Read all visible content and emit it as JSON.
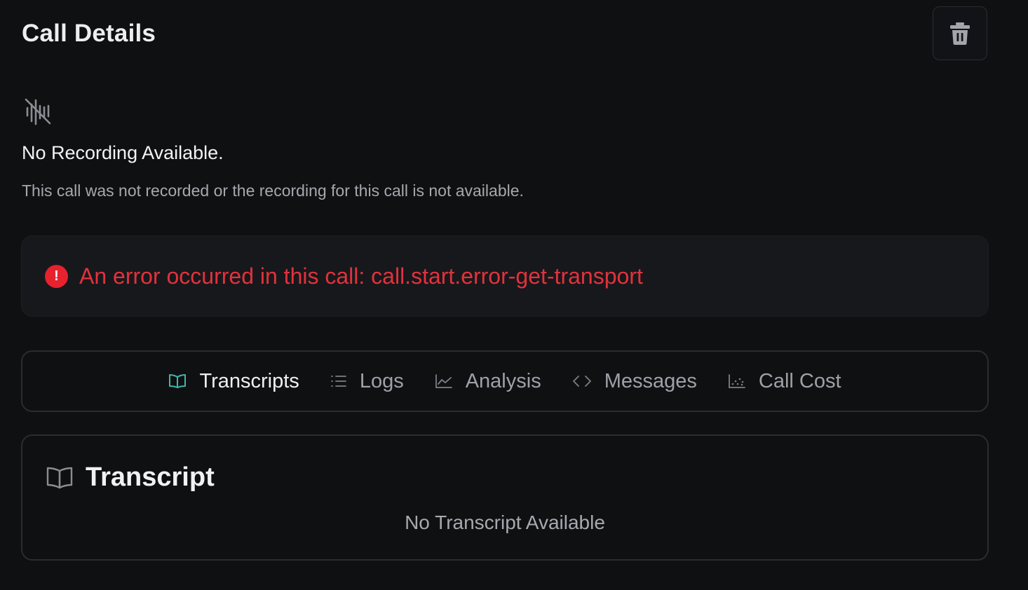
{
  "header": {
    "title": "Call Details",
    "delete_icon": "trash-icon"
  },
  "recording": {
    "icon": "audio-off-icon",
    "title": "No Recording Available.",
    "description": "This call was not recorded or the recording for this call is not available."
  },
  "error": {
    "icon": "alert-circle-icon",
    "message": "An error occurred in this call: call.start.error-get-transport",
    "color": "#e2323b"
  },
  "tabs": [
    {
      "label": "Transcripts",
      "icon": "book-open-icon",
      "active": true
    },
    {
      "label": "Logs",
      "icon": "list-icon",
      "active": false
    },
    {
      "label": "Analysis",
      "icon": "line-chart-icon",
      "active": false
    },
    {
      "label": "Messages",
      "icon": "code-icon",
      "active": false
    },
    {
      "label": "Call Cost",
      "icon": "scatter-chart-icon",
      "active": false
    }
  ],
  "transcript": {
    "icon": "book-open-icon",
    "title": "Transcript",
    "empty_text": "No Transcript Available"
  },
  "colors": {
    "background": "#0f1012",
    "accent": "#3fb8a8",
    "error": "#e5222e"
  }
}
